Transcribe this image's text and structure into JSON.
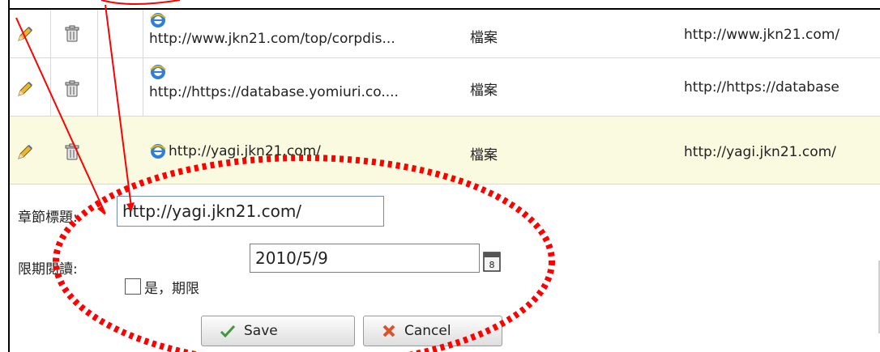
{
  "rows": [
    {
      "url": "http://www.jkn21.com/top/corpdis...",
      "type": "檔案",
      "url2": "http://www.jkn21.com/"
    },
    {
      "url": "http://https://database.yomiuri.co....",
      "type": "檔案",
      "url2": "http://https://database"
    },
    {
      "url": "http://yagi.jkn21.com/",
      "type": "檔案",
      "url2": "http://yagi.jkn21.com/"
    }
  ],
  "form": {
    "title_label": "章節標題:",
    "title_value": "http://yagi.jkn21.com/",
    "deadline_label": "限期閱讀:",
    "date_value": "2010/5/9",
    "checkbox_label": "是，期限",
    "save_label": "Save",
    "cancel_label": "Cancel"
  },
  "colors": {
    "highlight_row": "#fafae0",
    "annotation": "#ff0000"
  }
}
